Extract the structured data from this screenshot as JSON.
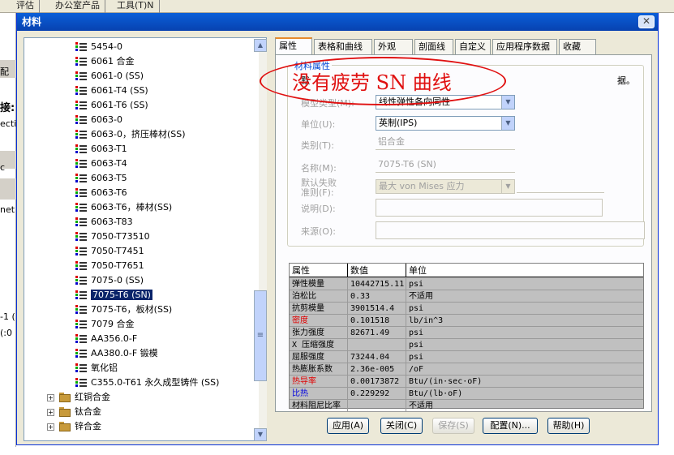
{
  "background": {
    "tabs": [
      "评估",
      "办公室产品",
      "工具(T)N"
    ],
    "left_fragments": [
      "配",
      "接:",
      "ecti",
      "c",
      "net",
      "-1 (",
      "(:0"
    ]
  },
  "dialog": {
    "title": "材料",
    "close_symbol": "✕"
  },
  "tree": {
    "items": [
      {
        "label": "5454-0",
        "selected": false
      },
      {
        "label": "6061 合金",
        "selected": false
      },
      {
        "label": "6061-0 (SS)",
        "selected": false
      },
      {
        "label": "6061-T4 (SS)",
        "selected": false
      },
      {
        "label": "6061-T6 (SS)",
        "selected": false
      },
      {
        "label": "6063-0",
        "selected": false
      },
      {
        "label": "6063-0，挤压棒材(SS)",
        "selected": false
      },
      {
        "label": "6063-T1",
        "selected": false
      },
      {
        "label": "6063-T4",
        "selected": false
      },
      {
        "label": "6063-T5",
        "selected": false
      },
      {
        "label": "6063-T6",
        "selected": false
      },
      {
        "label": "6063-T6，棒材(SS)",
        "selected": false
      },
      {
        "label": "6063-T83",
        "selected": false
      },
      {
        "label": "7050-T73510",
        "selected": false
      },
      {
        "label": "7050-T7451",
        "selected": false
      },
      {
        "label": "7050-T7651",
        "selected": false
      },
      {
        "label": "7075-0 (SS)",
        "selected": false
      },
      {
        "label": "7075-T6 (SN)",
        "selected": true
      },
      {
        "label": "7075-T6，板材(SS)",
        "selected": false
      },
      {
        "label": "7079 合金",
        "selected": false
      },
      {
        "label": "AA356.0-F",
        "selected": false
      },
      {
        "label": "AA380.0-F 锻模",
        "selected": false
      },
      {
        "label": "氧化铝",
        "selected": false
      },
      {
        "label": "C355.0-T61 永久成型铸件 (SS)",
        "selected": false
      }
    ],
    "folders": [
      "红铜合金",
      "钛合金",
      "锌合金"
    ]
  },
  "tabs": [
    "属性",
    "表格和曲线",
    "外观",
    "剖面线",
    "自定义",
    "应用程序数据",
    "收藏"
  ],
  "active_tab": 0,
  "properties": {
    "group_title": "材料属性",
    "description_start": "默",
    "description_end": "据。",
    "model_type_label": "模型类型(M):",
    "model_type_value": "线性弹性各向同性",
    "units_label": "单位(U):",
    "units_value": "英制(IPS)",
    "category_label": "类别(T):",
    "category_value": "铝合金",
    "name_label": "名称(M):",
    "name_value": "7075-T6 (SN)",
    "criterion_label_1": "默认失败",
    "criterion_label_2": "准则(F):",
    "criterion_value": "最大 von Mises 应力",
    "desc_label": "说明(D):",
    "source_label": "来源(O):"
  },
  "table": {
    "headers": [
      "属性",
      "数值",
      "单位"
    ],
    "rows": [
      {
        "name": "弹性模量",
        "value": "10442715.11",
        "unit": "psi",
        "color": "#000000"
      },
      {
        "name": "泊松比",
        "value": "0.33",
        "unit": "不适用",
        "color": "#000000"
      },
      {
        "name": "抗剪模量",
        "value": "3901514.4",
        "unit": "psi",
        "color": "#000000"
      },
      {
        "name": "密度",
        "value": "0.101518",
        "unit": "lb/in^3",
        "color": "#e00000"
      },
      {
        "name": "张力强度",
        "value": "82671.49",
        "unit": "psi",
        "color": "#000000"
      },
      {
        "name": "X 压缩强度",
        "value": "",
        "unit": "psi",
        "color": "#000000"
      },
      {
        "name": "屈服强度",
        "value": "73244.04",
        "unit": "psi",
        "color": "#000000"
      },
      {
        "name": "热膨胀系数",
        "value": "2.36e-005",
        "unit": "/oF",
        "color": "#000000"
      },
      {
        "name": "热导率",
        "value": "0.00173872",
        "unit": "Btu/(in·sec·oF)",
        "color": "#e00000"
      },
      {
        "name": "比热",
        "value": "0.229292",
        "unit": "Btu/(lb·oF)",
        "color": "#0000e0"
      },
      {
        "name": "材料阻尼比率",
        "value": "",
        "unit": "不适用",
        "color": "#000000"
      }
    ]
  },
  "buttons": {
    "apply": "应用(A)",
    "close": "关闭(C)",
    "save": "保存(S)",
    "config": "配置(N)...",
    "help": "帮助(H)"
  },
  "annotation": {
    "text": "没有疲劳 SN 曲线",
    "color": "#e01010"
  }
}
